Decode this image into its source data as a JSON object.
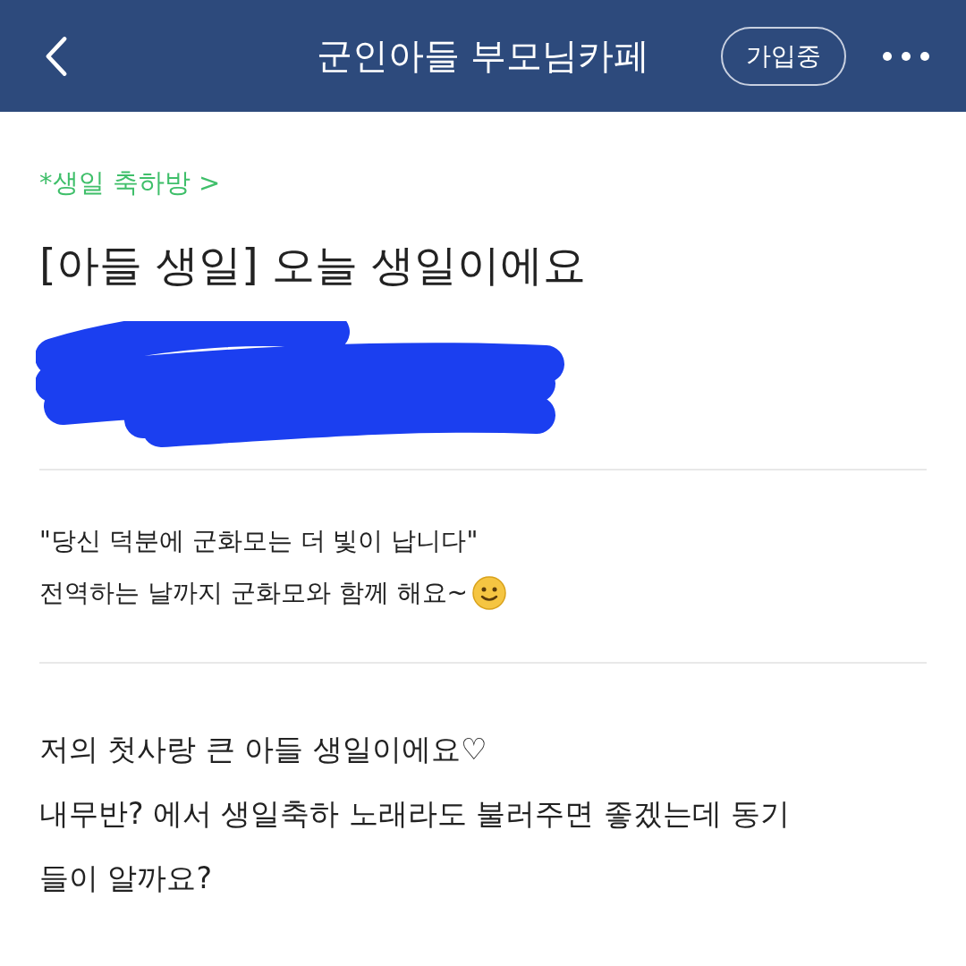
{
  "header": {
    "title": "군인아들 부모님카페",
    "membership_button": "가입중"
  },
  "board_link": "*생일 축하방 >",
  "post_title": "[아들 생일] 오늘 생일이에요",
  "author": {
    "redacted": true
  },
  "notice": {
    "lines": [
      "\"당신 덕분에 군화모는 더 빛이 납니다\"",
      "전역하는 날까지 군화모와 함께 해요~"
    ],
    "emoji": true
  },
  "body_lines": [
    "저의 첫사랑 큰 아들 생일이에요♡",
    "내무반? 에서 생일축하 노래라도 불러주면 좋겠는데 동기",
    "들이 알까요?"
  ]
}
